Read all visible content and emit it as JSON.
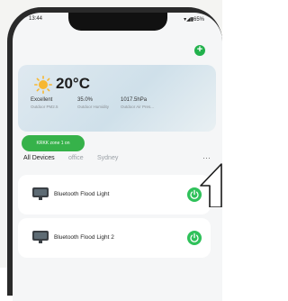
{
  "status_bar": {
    "time": "13:44",
    "indicators": "▾◢▮65%"
  },
  "header": {
    "add_icon": "plus-icon",
    "add_color": "#22b14c"
  },
  "weather": {
    "icon": "sun-icon",
    "temperature": "20°C",
    "stats": [
      {
        "value": "Excellent",
        "label": "Outdoor PM2.5"
      },
      {
        "value": "35.0%",
        "label": "Outdoor Humidity"
      },
      {
        "value": "1017.5hPa",
        "label": "Outdoor Air Pres..."
      }
    ]
  },
  "scene": {
    "label": "KRKK zone 1 on",
    "color": "#36b24a"
  },
  "tabs": [
    {
      "label": "All Devices",
      "active": true
    },
    {
      "label": "office",
      "active": false
    },
    {
      "label": "Sydney",
      "active": false
    }
  ],
  "tabs_more_icon": "ellipsis-icon",
  "devices": [
    {
      "name": "Bluetooth Flood Light",
      "icon": "flood-light-icon",
      "power_icon": "power-icon",
      "on": true
    },
    {
      "name": "Bluetooth Flood Light 2",
      "icon": "flood-light-icon",
      "power_icon": "power-icon",
      "on": true
    }
  ],
  "overlay": {
    "icon": "pointer-arrow-icon"
  }
}
